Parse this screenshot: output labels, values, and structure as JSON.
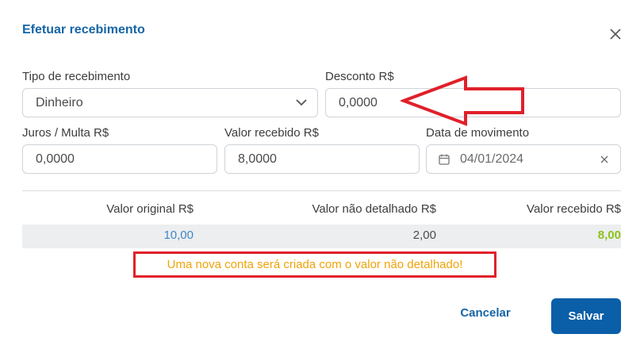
{
  "dialog": {
    "title": "Efetuar recebimento"
  },
  "form": {
    "tipo": {
      "label": "Tipo de recebimento",
      "value": "Dinheiro"
    },
    "desconto": {
      "label": "Desconto R$",
      "value": "0,0000"
    },
    "juros": {
      "label": "Juros / Multa R$",
      "value": "0,0000"
    },
    "valor_recebido": {
      "label": "Valor recebido R$",
      "value": "8,0000"
    },
    "data": {
      "label": "Data de movimento",
      "value": "04/01/2024"
    }
  },
  "summary": {
    "headers": [
      "Valor original R$",
      "Valor não detalhado R$",
      "Valor recebido R$"
    ],
    "values": [
      "10,00",
      "2,00",
      "8,00"
    ]
  },
  "warning": "Uma nova conta será criada com o valor não detalhado!",
  "actions": {
    "cancel": "Cancelar",
    "save": "Salvar"
  },
  "colors": {
    "accent": "#1565a6",
    "primary_button": "#0a5fa8",
    "warning_text": "#f0a30a",
    "highlight_red": "#e0202a",
    "original_value": "#3f86c7",
    "received_value": "#8cc21c"
  },
  "icons": {
    "close": "close-icon",
    "dropdown": "chevron-down-icon",
    "calendar": "calendar-icon",
    "clear": "clear-icon",
    "annotation": "arrow-annotation-icon"
  }
}
